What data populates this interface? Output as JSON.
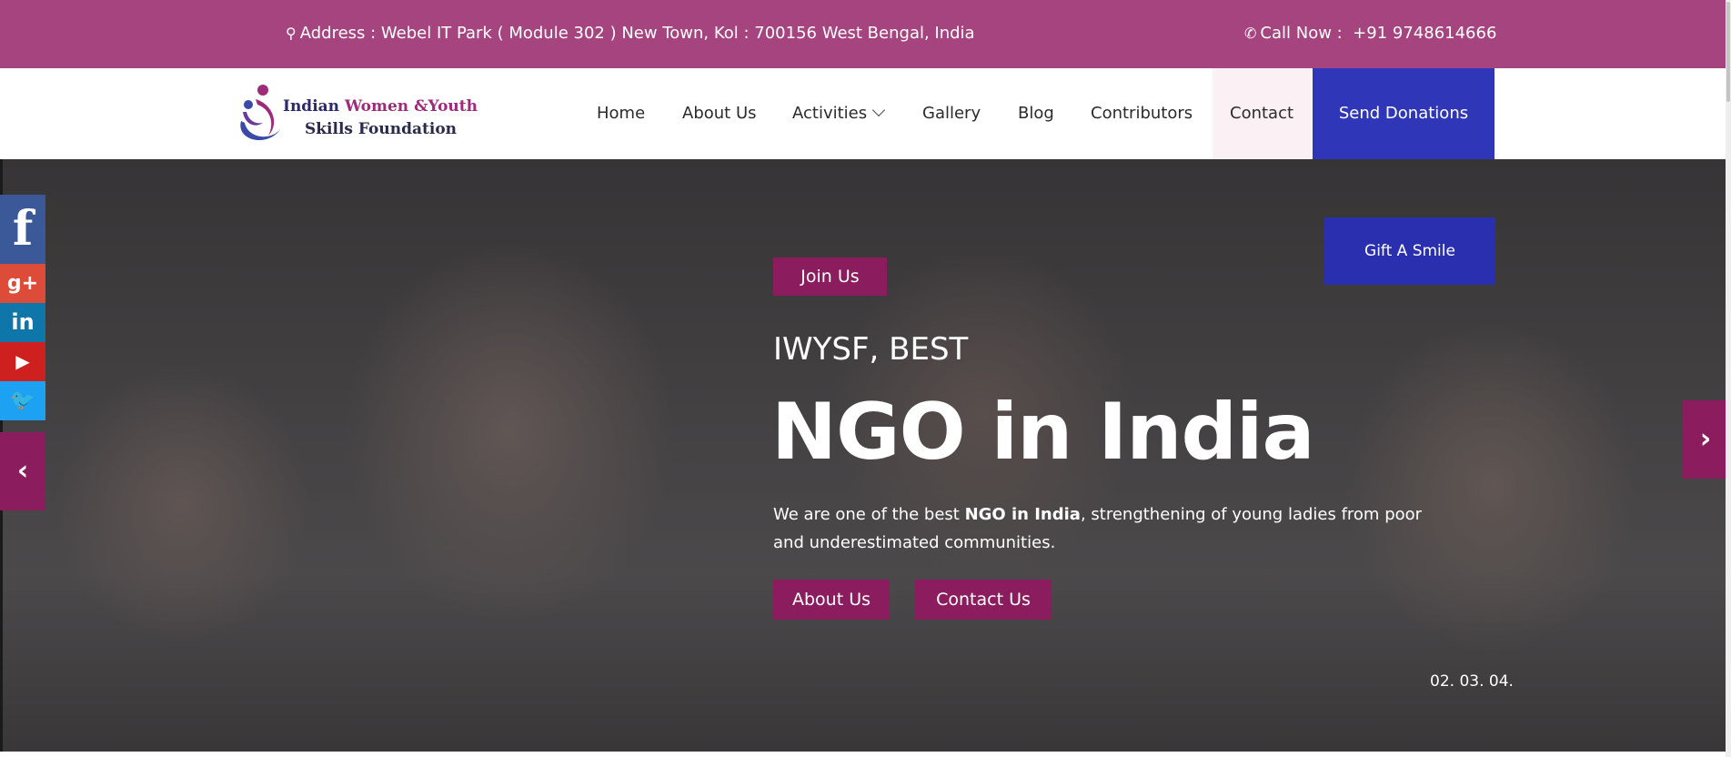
{
  "topbar": {
    "address": "Address : Webel IT Park ( Module 302 ) New Town, Kol : 700156 West Bengal, India",
    "call_label": "Call Now :",
    "phone": "+91 9748614666",
    "address_icon": "map-marker-icon",
    "phone_icon": "phone-icon"
  },
  "logo": {
    "line1_a": "Indian ",
    "line1_b": "Women",
    "line1_c": " &Youth",
    "line2": "Skills Foundation"
  },
  "nav": {
    "items": [
      "Home",
      "About Us",
      "Activities",
      "Gallery",
      "Blog",
      "Contributors",
      "Contact"
    ],
    "donate": "Send Donations"
  },
  "social": {
    "facebook": "f",
    "google_plus": "g+",
    "linkedin": "in",
    "youtube": "▶",
    "twitter": "🐦"
  },
  "hero": {
    "gift_button": "Gift A Smile",
    "join_label": "Join Us",
    "subtitle": "IWYSF, BEST",
    "headline": "NGO in India",
    "description_pre": "We are one of the best ",
    "description_bold": "NGO in India",
    "description_post": ", strengthening of young ladies from poor and underestimated communities.",
    "about_button": "About Us",
    "contact_button": "Contact Us",
    "pagination": "02. 03. 04."
  },
  "colors": {
    "brand": "#a5447e",
    "accent": "#8b1d5e",
    "donate": "#2f37b8"
  }
}
